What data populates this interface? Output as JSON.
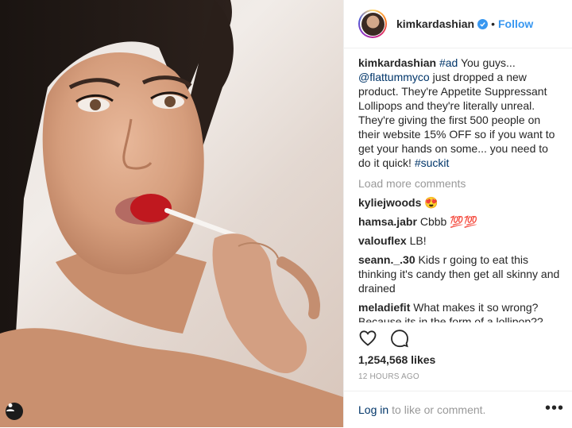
{
  "post": {
    "username": "kimkardashian",
    "dot": "•",
    "follow_label": "Follow",
    "caption": {
      "user": "kimkardashian",
      "tag_ad": "#ad",
      "text_1": " You guys... ",
      "mention": "@flattummyco",
      "text_2": " just dropped a new product. They're Appetite Suppressant Lollipops and they're literally unreal. They're giving the first 500 people on their website 15% OFF so if you want to get your hands on some... you need to do it quick! ",
      "tag_end": "#suckit"
    },
    "load_more": "Load more comments",
    "comments": [
      {
        "user": "kyliejwoods",
        "text": "😍"
      },
      {
        "user": "hamsa.jabr",
        "text": "Cbbb 💯💯"
      },
      {
        "user": "valouflex",
        "text": "LB!"
      },
      {
        "user": "seann._.30",
        "text": "Kids r going to eat this thinking it's candy then get all skinny and drained"
      },
      {
        "user": "meladiefit",
        "text": "What makes it so wrong? Because its in the form of a lollipop?? Get over yourselves. There are shakes that do"
      }
    ],
    "likes": "1,254,568 likes",
    "time": "12 HOURS AGO",
    "footer": {
      "login": "Log in",
      "rest": "to like or comment.",
      "more": "•••"
    }
  },
  "icons": {
    "heart": "heart-icon",
    "comment": "comment-icon",
    "verified": "verified-badge-icon",
    "tag": "user-tag-icon"
  },
  "colors": {
    "accent": "#3897f0",
    "link": "#003569",
    "muted": "#999999",
    "text": "#262626"
  }
}
